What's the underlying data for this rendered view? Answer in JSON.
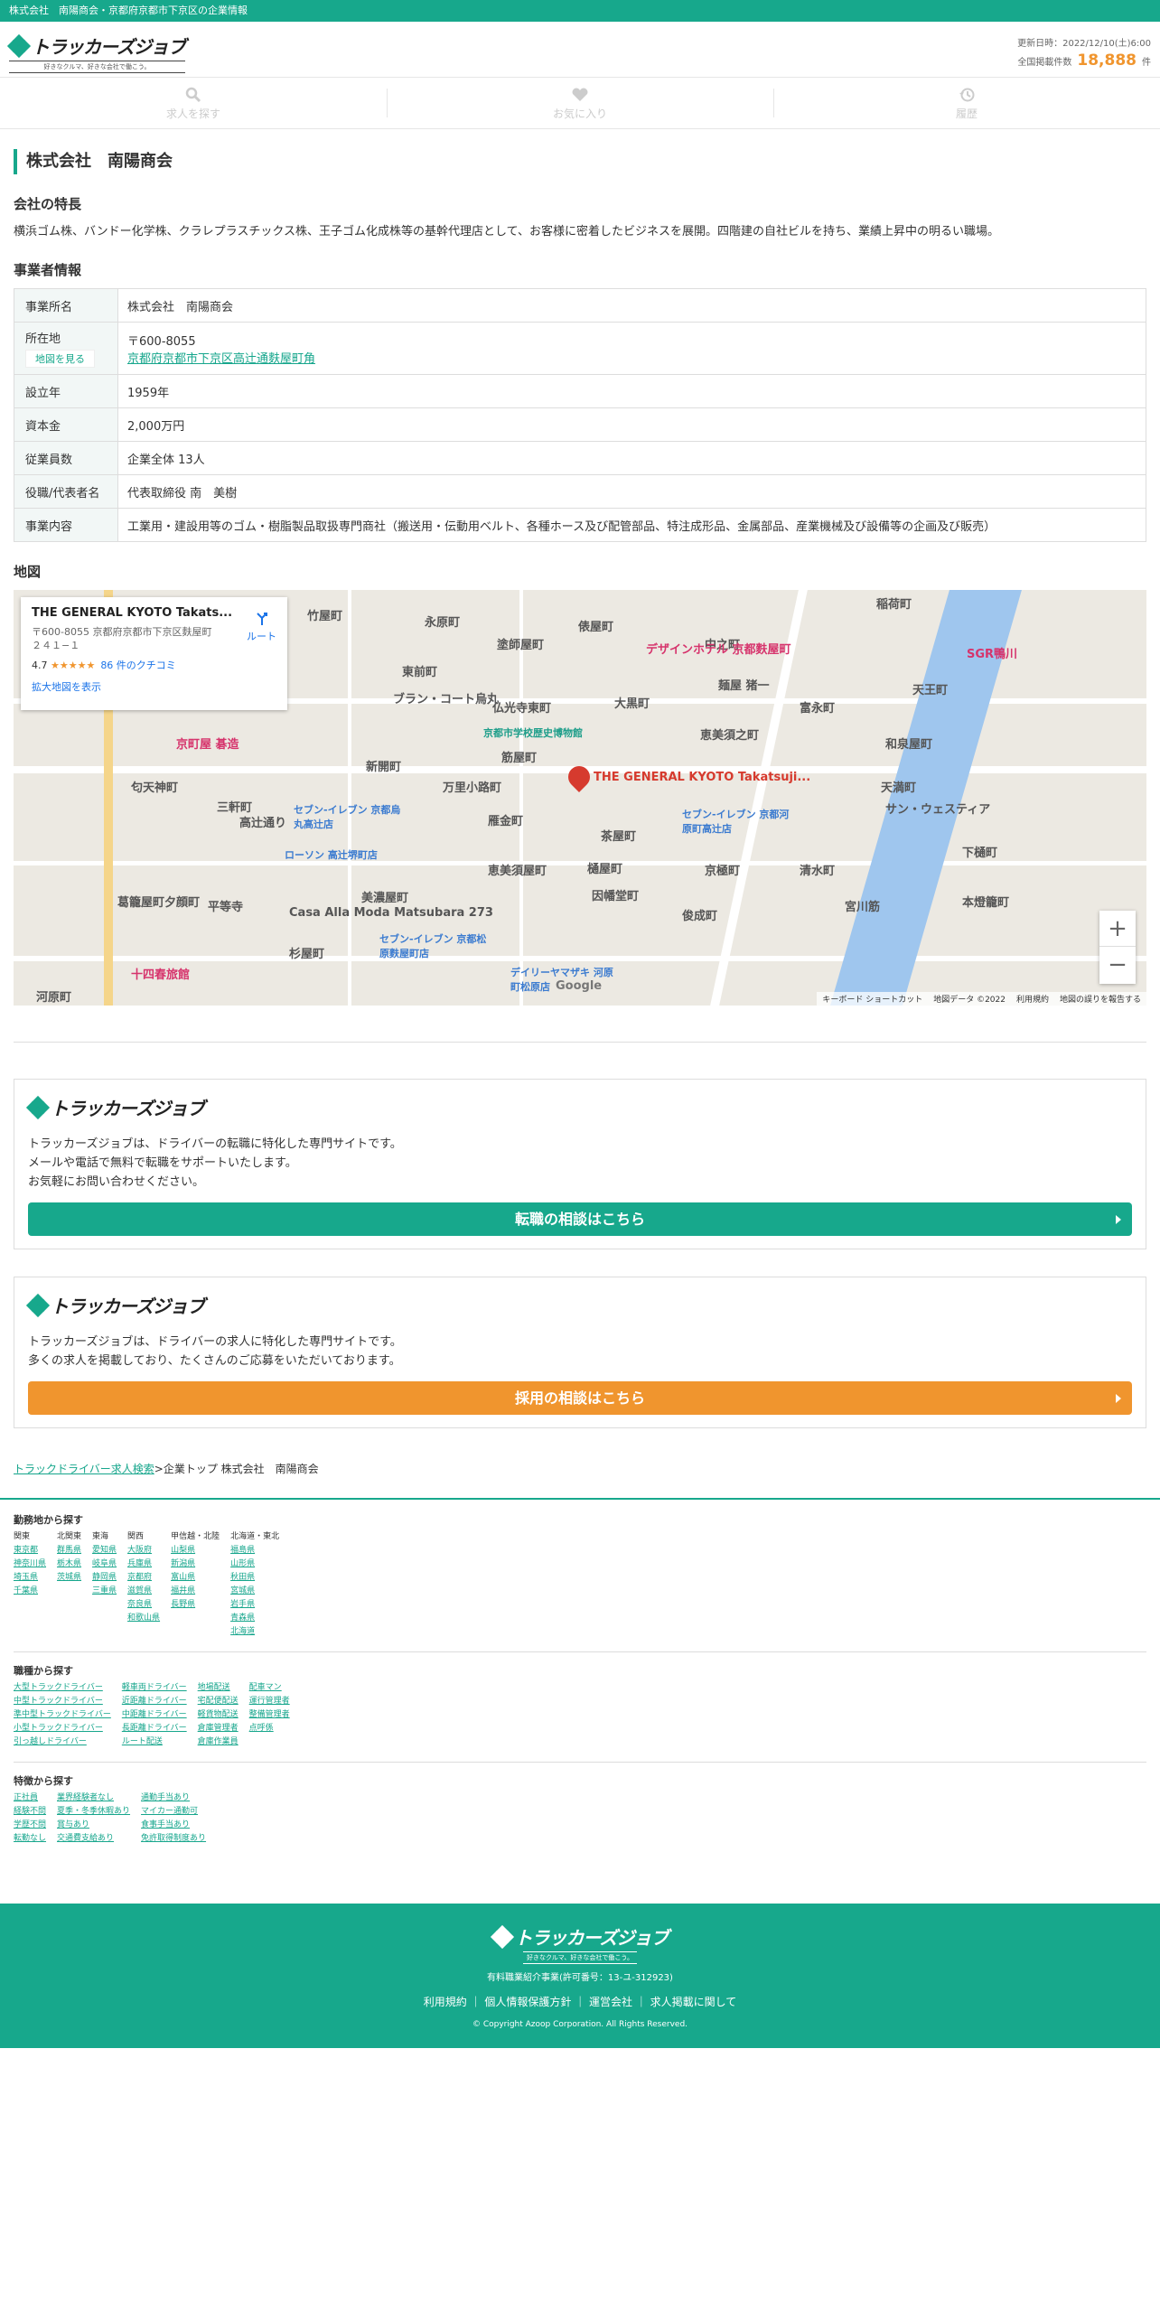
{
  "topbar": {
    "text": "株式会社　南陽商会・京都府京都市下京区の企業情報"
  },
  "header": {
    "logo_text": "トラッカーズジョブ",
    "logo_tagline": "好きなクルマ、好きな会社で働こう。",
    "updated": "更新日時：2022/12/10(土)6:00",
    "count_label": "全国掲載件数",
    "count": "18,888",
    "count_unit": "件"
  },
  "nav": {
    "search": "求人を探す",
    "favorites": "お気に入り",
    "history": "履歴"
  },
  "company": {
    "title": "株式会社　南陽商会"
  },
  "feature": {
    "heading": "会社の特長",
    "text": "横浜ゴム株、バンドー化学株、クラレプラスチックス株、王子ゴム化成株等の基幹代理店として、お客様に密着したビジネスを展開。四階建の自社ビルを持ち、業績上昇中の明るい職場。"
  },
  "info": {
    "heading": "事業者情報",
    "rows": [
      {
        "label": "事業所名",
        "value": "株式会社　南陽商会"
      },
      {
        "label": "所在地",
        "postal": "〒600-8055",
        "map_button": "地図を見る",
        "address_link": "京都府京都市下京区高辻通麩屋町角"
      },
      {
        "label": "設立年",
        "value": "1959年"
      },
      {
        "label": "資本金",
        "value": "2,000万円"
      },
      {
        "label": "従業員数",
        "value": "企業全体 13人"
      },
      {
        "label": "役職/代表者名",
        "value": "代表取締役 南　美樹"
      },
      {
        "label": "事業内容",
        "value": "工業用・建設用等のゴム・樹脂製品取扱専門商社（搬送用・伝動用ベルト、各種ホース及び配管部品、特注成形品、金属部品、産業機械及び設備等の企画及び販売）"
      }
    ]
  },
  "map": {
    "heading": "地図",
    "card_title": "THE GENERAL KYOTO Takats...",
    "card_address": "〒600-8055 京都府京都市下京区麩屋町２４１−１",
    "card_rating": "4.7",
    "card_stars": "★★★★★",
    "card_reviews": "86 件のクチコミ",
    "card_route": "ルート",
    "card_enlarge": "拡大地図を表示",
    "pin_label": "THE GENERAL KYOTO Takatsuji...",
    "places": [
      "竹屋町",
      "永原町",
      "塗師屋町",
      "俵屋町",
      "中之町",
      "稲荷町",
      "デザインホテル 京都麩屋町",
      "東前町",
      "仏光寺東町",
      "大黒町",
      "富永町",
      "天王町",
      "京都市学校歴史博物館",
      "恵美須之町",
      "和泉屋町",
      "京町屋 碁造",
      "筋屋町",
      "匂天神町",
      "新開町",
      "万里小路町",
      "天満町",
      "三軒町",
      "雁金町",
      "高辻通り",
      "茶屋町",
      "セブン-イレブン 京都河原町高辻店",
      "ローソン 高辻堺町店",
      "恵美須屋町",
      "樋屋町",
      "京極町",
      "清水町",
      "下樋町",
      "因幡堂町",
      "葛籠屋町夕顔町",
      "美濃屋町",
      "宮川筋",
      "本燈籠町",
      "杉屋町",
      "セブン-イレブン 京都松原麩屋町店",
      "デイリーヤマザキ 河原町松原店",
      "俊成町",
      "十四春旅館",
      "河原町",
      "SGR鴨川",
      "サン・ウェスティア",
      "ブラン・コート烏丸",
      "平等寺",
      "Casa Alla Moda Matsubara 273",
      "セブン-イレブン 京都烏丸高辻店",
      "麺屋 猪一"
    ],
    "zoom_in": "+",
    "zoom_out": "−",
    "google": "Google",
    "footer": [
      "キーボード ショートカット",
      "地図データ ©2022",
      "利用規約",
      "地図の誤りを報告する"
    ]
  },
  "cta": [
    {
      "text": [
        "トラッカーズジョブは、ドライバーの転職に特化した専門サイトです。",
        "メールや電話で無料で転職をサポートいたします。",
        "お気軽にお問い合わせください。"
      ],
      "button": "転職の相談はこちら"
    },
    {
      "text": [
        "トラッカーズジョブは、ドライバーの求人に特化した専門サイトです。",
        "多くの求人を掲載しており、たくさんのご応募をいただいております。"
      ],
      "button": "採用の相談はこちら"
    }
  ],
  "breadcrumb": {
    "link": "トラックドライバー求人検索",
    "sep": ">",
    "current": "企業トップ 株式会社　南陽商会"
  },
  "footnav": {
    "area_title": "勤務地から探す",
    "areas": [
      {
        "h": "関東",
        "items": [
          "東京都",
          "神奈川県",
          "埼玉県",
          "千葉県"
        ]
      },
      {
        "h": "北関東",
        "items": [
          "群馬県",
          "栃木県",
          "茨城県"
        ]
      },
      {
        "h": "東海",
        "items": [
          "愛知県",
          "岐阜県",
          "静岡県",
          "三重県"
        ]
      },
      {
        "h": "関西",
        "items": [
          "大阪府",
          "兵庫県",
          "京都府",
          "滋賀県",
          "奈良県",
          "和歌山県"
        ]
      },
      {
        "h": "甲信越・北陸",
        "items": [
          "山梨県",
          "新潟県",
          "富山県",
          "福井県",
          "長野県"
        ]
      },
      {
        "h": "北海道・東北",
        "items": [
          "福島県",
          "山形県",
          "秋田県",
          "宮城県",
          "岩手県",
          "青森県",
          "北海道"
        ]
      }
    ],
    "job_title": "職種から探す",
    "jobs": [
      [
        "大型トラックドライバー",
        "中型トラックドライバー",
        "準中型トラックドライバー",
        "小型トラックドライバー",
        "引っ越しドライバー"
      ],
      [
        "軽車両ドライバー",
        "近距離ドライバー",
        "中距離ドライバー",
        "長距離ドライバー",
        "ルート配送"
      ],
      [
        "地場配送",
        "宅配便配送",
        "軽貨物配送",
        "倉庫管理者",
        "倉庫作業員"
      ],
      [
        "配車マン",
        "運行管理者",
        "整備管理者",
        "点呼係"
      ]
    ],
    "feat_title": "特徴から探す",
    "features": [
      [
        "正社員",
        "経験不問",
        "学歴不問",
        "転勤なし"
      ],
      [
        "業界経験者なし",
        "夏季・冬季休暇あり",
        "賞与あり",
        "交通費支給あり"
      ],
      [
        "通勤手当あり",
        "マイカー通勤可",
        "食事手当あり",
        "免許取得制度あり"
      ]
    ]
  },
  "footer": {
    "logo_text": "トラッカーズジョブ",
    "logo_tagline": "好きなクルマ、好きな会社で働こう。",
    "license": "有料職業紹介事業(許可番号：13-ユ-312923)",
    "links": [
      "利用規約",
      "個人情報保護方針",
      "運営会社",
      "求人掲載に関して"
    ],
    "copyright": "© Copyright Azoop Corporation. All Rights Reserved."
  }
}
